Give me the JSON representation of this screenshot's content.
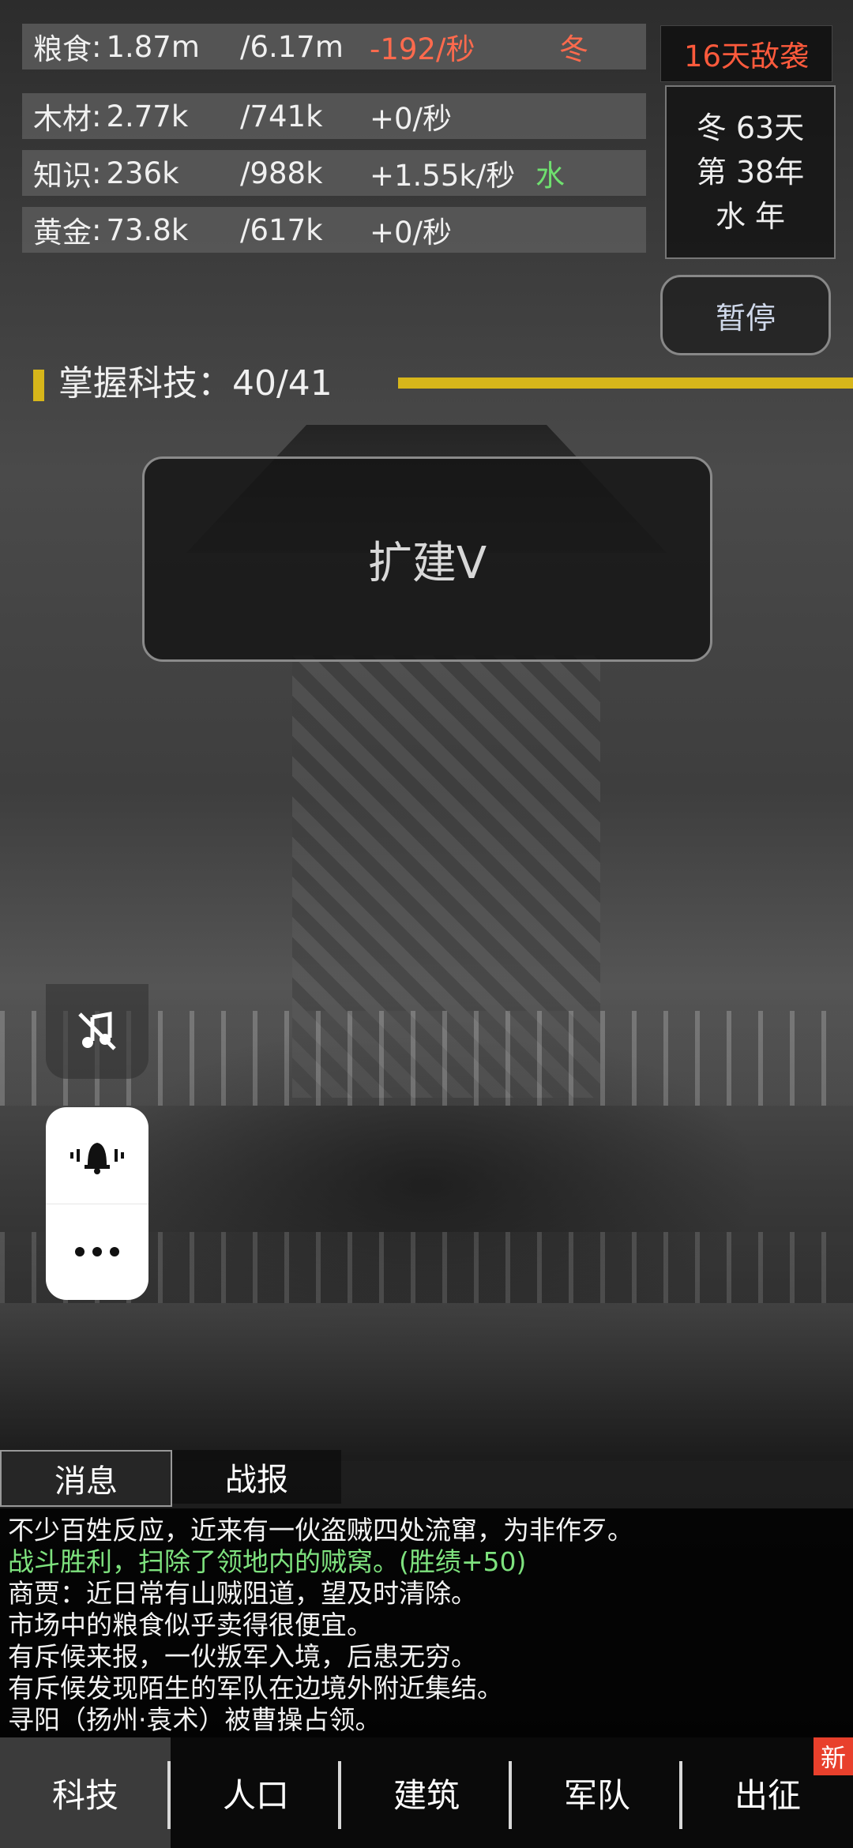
{
  "resources": [
    {
      "name": "粮食",
      "current": "1.87m",
      "capacity": "/6.17m",
      "rate": "-192/秒",
      "tag": "冬",
      "rate_color": "#ff6a4d",
      "tag_color": "#ff6a4d"
    },
    {
      "name": "木材",
      "current": "2.77k",
      "capacity": "/741k",
      "rate": "+0/秒",
      "tag": "",
      "rate_color": "#f0f0f0",
      "tag_color": "#f0f0f0"
    },
    {
      "name": "知识",
      "current": "236k",
      "capacity": "/988k",
      "rate": "+1.55k/秒",
      "tag": "水",
      "rate_color": "#f0f0f0",
      "tag_color": "#6fe06f"
    },
    {
      "name": "黄金",
      "current": "73.8k",
      "capacity": "/617k",
      "rate": "+0/秒",
      "tag": "",
      "rate_color": "#f0f0f0",
      "tag_color": "#f0f0f0"
    }
  ],
  "raid_warning": "16天敌袭",
  "date": {
    "line1": "冬 63天",
    "line2": "第 38年",
    "line3": "水 年"
  },
  "pause_label": "暂停",
  "tech": {
    "label": "掌握科技：40/41",
    "progress_fraction": 0.976
  },
  "tech_button_label": "扩建V",
  "side_icons": {
    "mute": "music-off-icon",
    "bell": "vibrate-bell-icon",
    "more": "more-dots-icon"
  },
  "message_tabs": [
    "消息",
    "战报"
  ],
  "log": [
    {
      "text": "不少百姓反应，近来有一伙盗贼四处流窜，为非作歹。",
      "type": "normal"
    },
    {
      "text": "战斗胜利，扫除了领地内的贼窝。(胜绩+50)",
      "type": "win"
    },
    {
      "text": "商贾：近日常有山贼阻道，望及时清除。",
      "type": "normal"
    },
    {
      "text": "市场中的粮食似乎卖得很便宜。",
      "type": "normal"
    },
    {
      "text": "有斥候来报，一伙叛军入境，后患无穷。",
      "type": "normal"
    },
    {
      "text": "有斥候发现陌生的军队在边境外附近集结。",
      "type": "normal"
    },
    {
      "text": "寻阳（扬州·袁术）被曹操占领。",
      "type": "normal"
    }
  ],
  "nav": [
    {
      "label": "科技",
      "active": true,
      "badge": ""
    },
    {
      "label": "人口",
      "active": false,
      "badge": ""
    },
    {
      "label": "建筑",
      "active": false,
      "badge": ""
    },
    {
      "label": "军队",
      "active": false,
      "badge": ""
    },
    {
      "label": "出征",
      "active": false,
      "badge": "新"
    }
  ],
  "colors": {
    "accent": "#d7b61a",
    "warning": "#ff5a3c",
    "positive": "#7ee27e"
  }
}
